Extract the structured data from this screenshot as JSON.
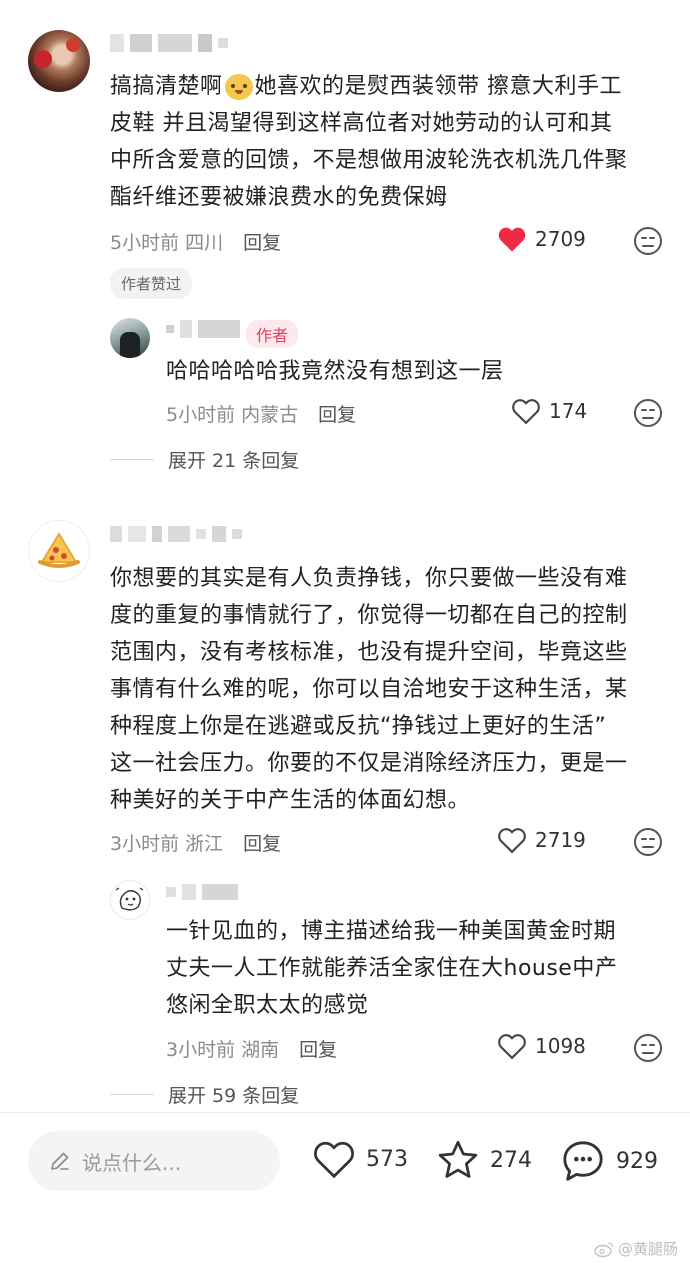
{
  "comments": [
    {
      "text_lines": [
        "搞搞清楚啊",
        "她喜欢的是熨西装领带 擦意大利手工",
        "皮鞋 并且渴望得到这样高位者对她劳动的认可和其",
        "中所含爱意的回馈，不是想做用波轮洗衣机洗几件聚",
        "酯纤维还要被嫌浪费水的免费保姆"
      ],
      "time": "5小时前",
      "location": "四川",
      "reply_label": "回复",
      "likes": "2709",
      "liked": true,
      "author_liked": "作者赞过",
      "reply": {
        "author_badge": "作者",
        "text_lines": [
          "哈哈哈哈哈我竟然没有想到这一层"
        ],
        "time": "5小时前",
        "location": "内蒙古",
        "reply_label": "回复",
        "likes": "174"
      },
      "expand": "展开 21 条回复"
    },
    {
      "text_lines": [
        "你想要的其实是有人负责挣钱，你只要做一些没有难",
        "度的重复的事情就行了，你觉得一切都在自己的控制",
        "范围内，没有考核标准，也没有提升空间，毕竟这些",
        "事情有什么难的呢，你可以自洽地安于这种生活，某",
        "种程度上你是在逃避或反抗“挣钱过上更好的生活”",
        "这一社会压力。你要的不仅是消除经济压力，更是一",
        "种美好的关于中产生活的体面幻想。"
      ],
      "time": "3小时前",
      "location": "浙江",
      "reply_label": "回复",
      "likes": "2719",
      "liked": false,
      "reply": {
        "text_lines": [
          "一针见血的，博主描述给我一种美国黄金时期",
          "丈夫一人工作就能养活全家住在大house中产",
          "悠闲全职太太的感觉"
        ],
        "time": "3小时前",
        "location": "湖南",
        "reply_label": "回复",
        "likes": "1098"
      },
      "expand": "展开 59 条回复"
    }
  ],
  "bottom_bar": {
    "input_placeholder": "说点什么...",
    "likes": "573",
    "favorites": "274",
    "comments": "929"
  },
  "watermark": "@黄腿肠",
  "colors": {
    "like_red": "#ee2b47",
    "badge_red": "#e0405e"
  }
}
